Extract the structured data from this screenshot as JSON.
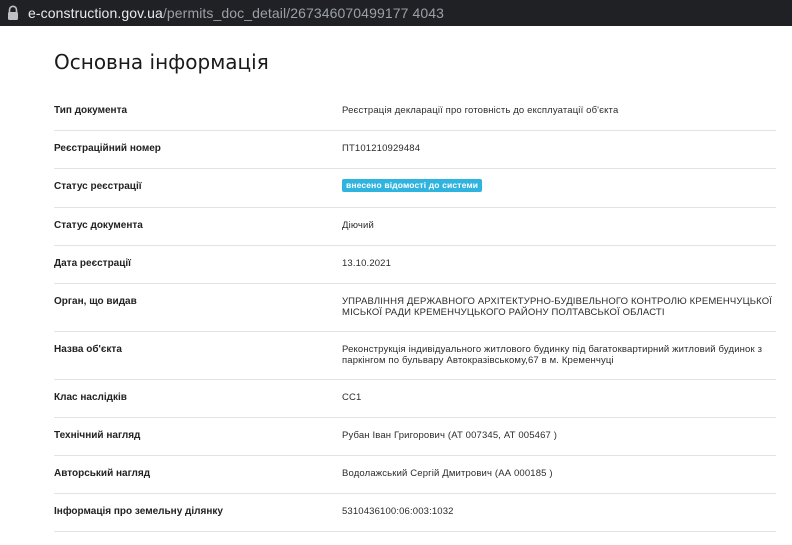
{
  "browser": {
    "url_host": "e-construction.gov.ua",
    "url_path": "/permits_doc_detail/267346070499177 4043",
    "lock_icon": "lock-icon"
  },
  "main": {
    "title": "Основна інформація",
    "rows": [
      {
        "label": "Тип документа",
        "value": "Реєстрація декларації про готовність до експлуатації об'єкта"
      },
      {
        "label": "Реєстраційний номер",
        "value": "ПТ101210929484"
      },
      {
        "label": "Статус реєстрації",
        "value": "внесено відомості до системи"
      },
      {
        "label": "Статус документа",
        "value": "Діючий"
      },
      {
        "label": "Дата реєстрації",
        "value": "13.10.2021"
      },
      {
        "label": "Орган, що видав",
        "value": "УПРАВЛІННЯ ДЕРЖАВНОГО АРХІТЕКТУРНО-БУДІВЕЛЬНОГО КОНТРОЛЮ КРЕМЕНЧУЦЬКОЇ МІСЬКОЇ РАДИ КРЕМЕНЧУЦЬКОГО РАЙОНУ ПОЛТАВСЬКОЇ ОБЛАСТІ"
      },
      {
        "label": "Назва об'єкта",
        "value": "Реконструкція індивідуального житлового будинку під багатоквартирний житловий будинок з паркінгом по бульвару Автокразівському,67 в м. Кременчуці"
      },
      {
        "label": "Клас наслідків",
        "value": "СС1"
      },
      {
        "label": "Технічний нагляд",
        "value": "Рубан Іван Григорович (АТ 007345, АТ 005467 )"
      },
      {
        "label": "Авторський нагляд",
        "value": "Водолажський Сергій Дмитрович (АА 000185 )"
      },
      {
        "label": "Інформація про земельну ділянку",
        "value": "5310436100:06:003:1032"
      }
    ]
  },
  "colors": {
    "badge": "#2fb4e0",
    "addressbar": "#202124"
  }
}
